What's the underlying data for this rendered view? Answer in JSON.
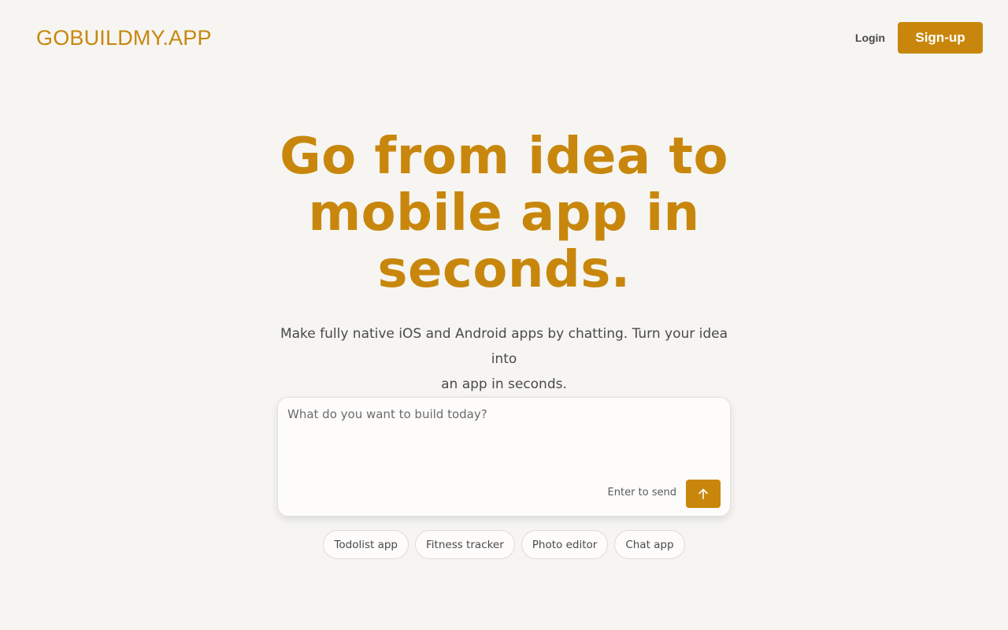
{
  "brand": {
    "logo_text": "GOBUILDMY.APP",
    "accent_color": "#c8870c",
    "background_color": "#f6f5f2"
  },
  "header": {
    "login_label": "Login",
    "signup_label": "Sign-up"
  },
  "hero": {
    "title_lines": [
      "Go from idea to",
      "mobile app in",
      "seconds."
    ],
    "subtitle_lines": [
      "Make fully native iOS and Android apps by chatting. Turn your idea into",
      "an app in seconds."
    ]
  },
  "prompt": {
    "placeholder": "What do you want to build today?",
    "value": "",
    "send_hint": "Enter to send",
    "send_icon": "arrow-up-icon"
  },
  "suggestions": [
    {
      "label": "Todolist app"
    },
    {
      "label": "Fitness tracker"
    },
    {
      "label": "Photo editor"
    },
    {
      "label": "Chat app"
    }
  ]
}
